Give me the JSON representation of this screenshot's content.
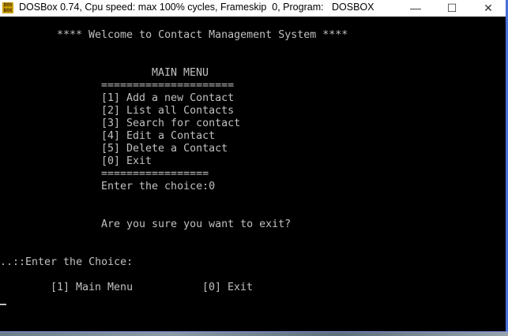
{
  "window": {
    "icon_text": "DOS BOX",
    "title": "DOSBox 0.74, Cpu speed: max 100% cycles, Frameskip  0, Program:   DOSBOX",
    "minimize": "—",
    "maximize": "☐",
    "close": "✕"
  },
  "terminal": {
    "welcome": "**** Welcome to Contact Management System ****",
    "menu_title": "MAIN MENU",
    "separator_top": "=====================",
    "items": [
      "[1] Add a new Contact",
      "[2] List all Contacts",
      "[3] Search for contact",
      "[4] Edit a Contact",
      "[5] Delete a Contact",
      "[0] Exit"
    ],
    "separator_bottom": "=================",
    "enter_choice": "Enter the choice:0",
    "confirm_exit": "Are you sure you want to exit?",
    "prompt": "..::Enter the Choice:",
    "option_main_menu": "[1] Main Menu",
    "option_exit": "[0] Exit"
  }
}
